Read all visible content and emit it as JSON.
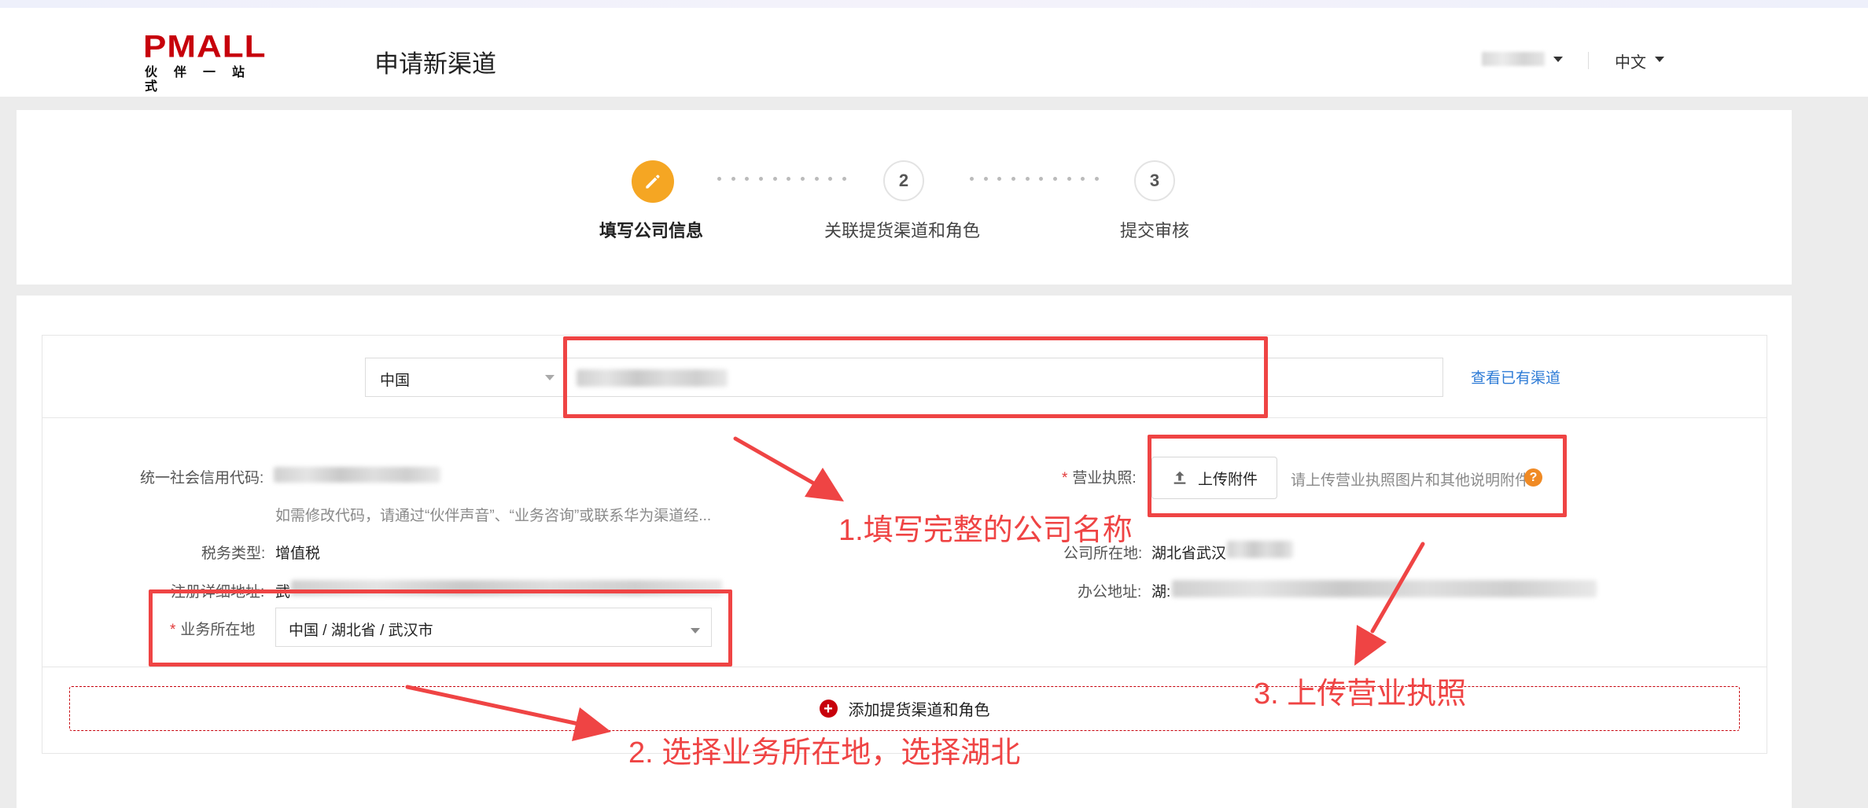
{
  "header": {
    "logo_main": "PMALL",
    "logo_sub": "伙伴一站式",
    "page_title": "申请新渠道",
    "language": "中文"
  },
  "steps": [
    {
      "label": "填写公司信息",
      "number": "",
      "state": "active",
      "icon": "pencil-icon"
    },
    {
      "label": "关联提货渠道和角色",
      "number": "2",
      "state": "pending"
    },
    {
      "label": "提交审核",
      "number": "3",
      "state": "pending"
    }
  ],
  "company": {
    "country": "中国",
    "view_channels_link": "查看已有渠道"
  },
  "form": {
    "credit_code_label": "统一社会信用代码:",
    "credit_code_hint": "如需修改代码，请通过“伙伴声音”、“业务咨询”或联系华为渠道经...",
    "tax_type_label": "税务类型:",
    "tax_type_value": "增值税",
    "reg_address_label": "注册详细地址:",
    "reg_address_value": "武",
    "business_location_label": "业务所在地",
    "business_location_value": "中国 / 湖北省 / 武汉市",
    "license_label": "营业执照:",
    "upload_button": "上传附件",
    "upload_hint": "请上传营业执照图片和其他说明附件",
    "company_location_label": "公司所在地:",
    "company_location_value": "湖北省武汉",
    "office_address_label": "办公地址:",
    "office_address_value": "湖:"
  },
  "add_channel_button": "添加提货渠道和角色",
  "annotations": [
    {
      "text": "1.填写完整的公司名称"
    },
    {
      "text": "2. 选择业务所在地，选择湖北"
    },
    {
      "text": "3. 上传营业执照"
    }
  ],
  "colors": {
    "brand_red": "#c7000b",
    "step_active": "#f5a623",
    "link_blue": "#2d7bd6",
    "annotation_red": "#ef4444",
    "help_icon": "#f08a24"
  }
}
